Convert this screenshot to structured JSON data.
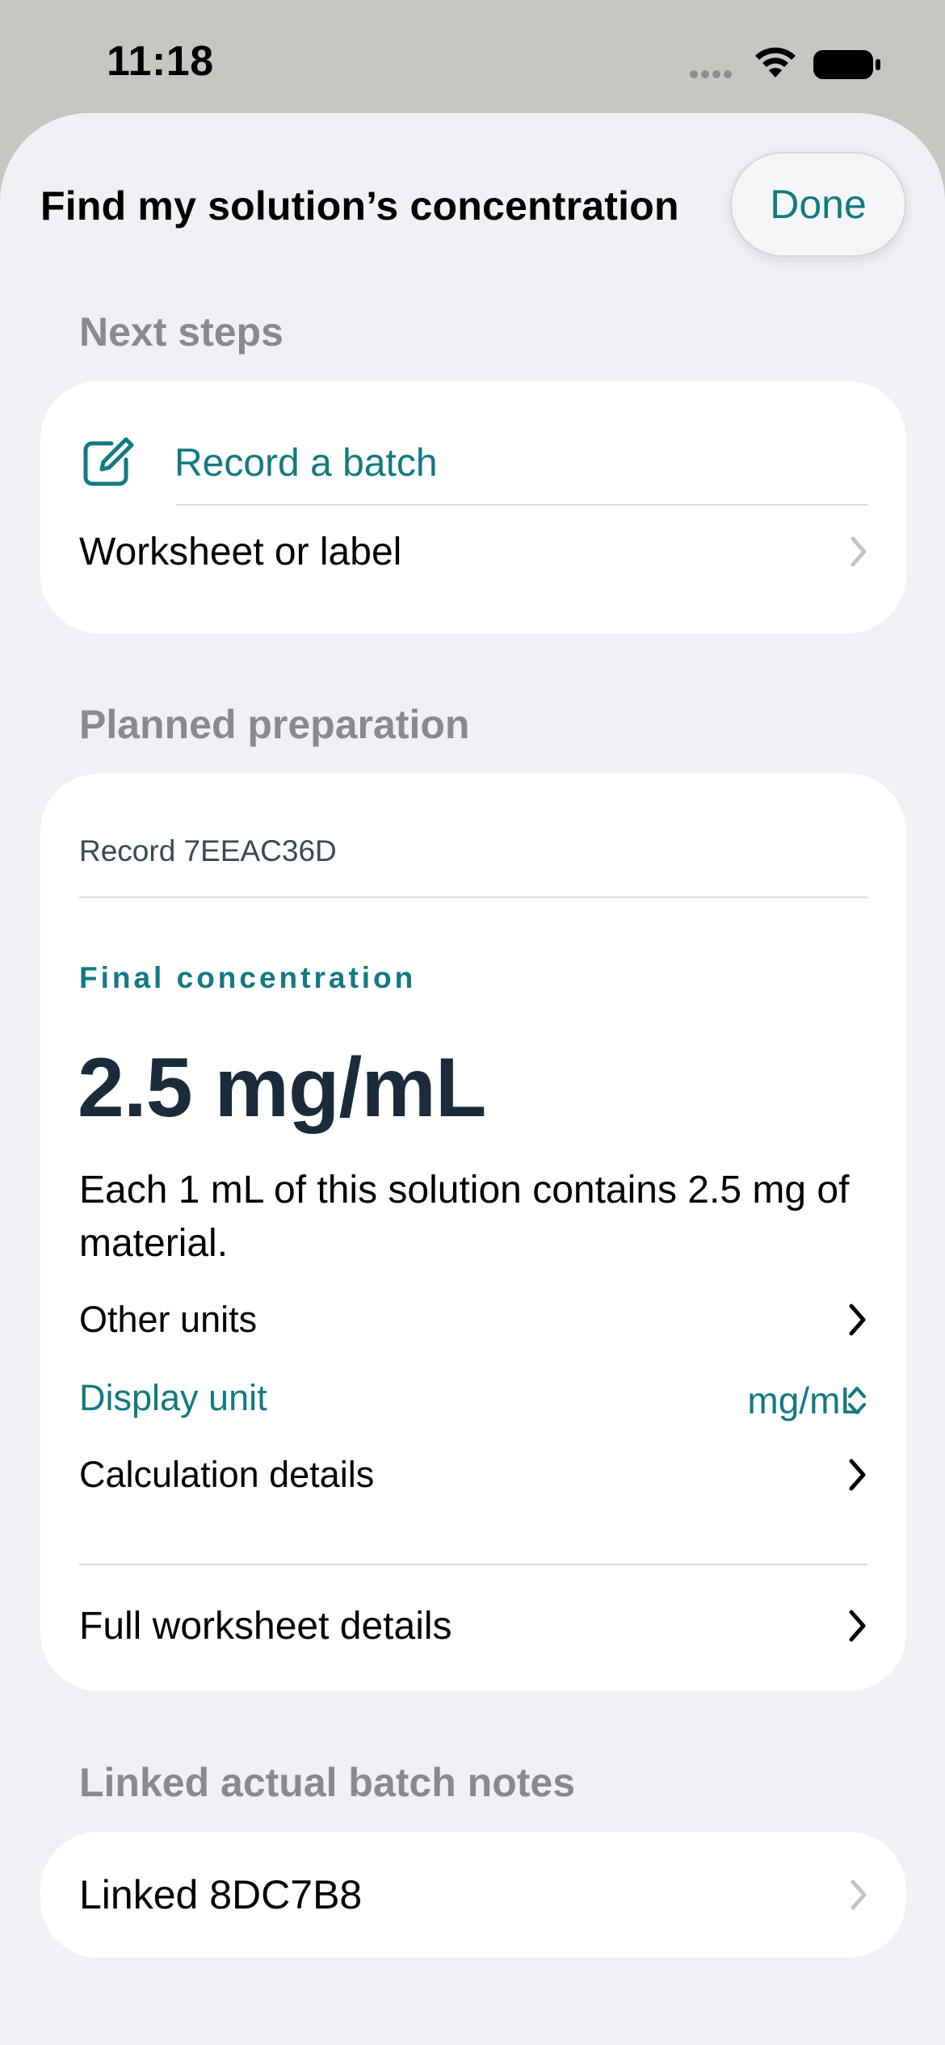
{
  "status_bar": {
    "time": "11:18"
  },
  "sheet": {
    "title": "Find my solution’s concentration",
    "done_label": "Done"
  },
  "next_steps": {
    "header": "Next steps",
    "record_batch": "Record a batch",
    "worksheet_label": "Worksheet or label"
  },
  "planned": {
    "header": "Planned preparation",
    "record_id": "Record 7EEAC36D",
    "final_label": "Final concentration",
    "value": "2.5 mg/mL",
    "description": "Each 1 mL of this solution contains 2.5 mg of material.",
    "other_units": "Other units",
    "display_unit_label": "Display unit",
    "display_unit_value": "mg/mL",
    "calc_details": "Calculation details",
    "full_worksheet": "Full worksheet details"
  },
  "linked": {
    "header": "Linked actual batch notes",
    "item": "Linked 8DC7B8"
  },
  "colors": {
    "accent": "#127a80",
    "background": "#f1f0f5",
    "card": "#ffffff",
    "heading": "#1b2b3a"
  }
}
